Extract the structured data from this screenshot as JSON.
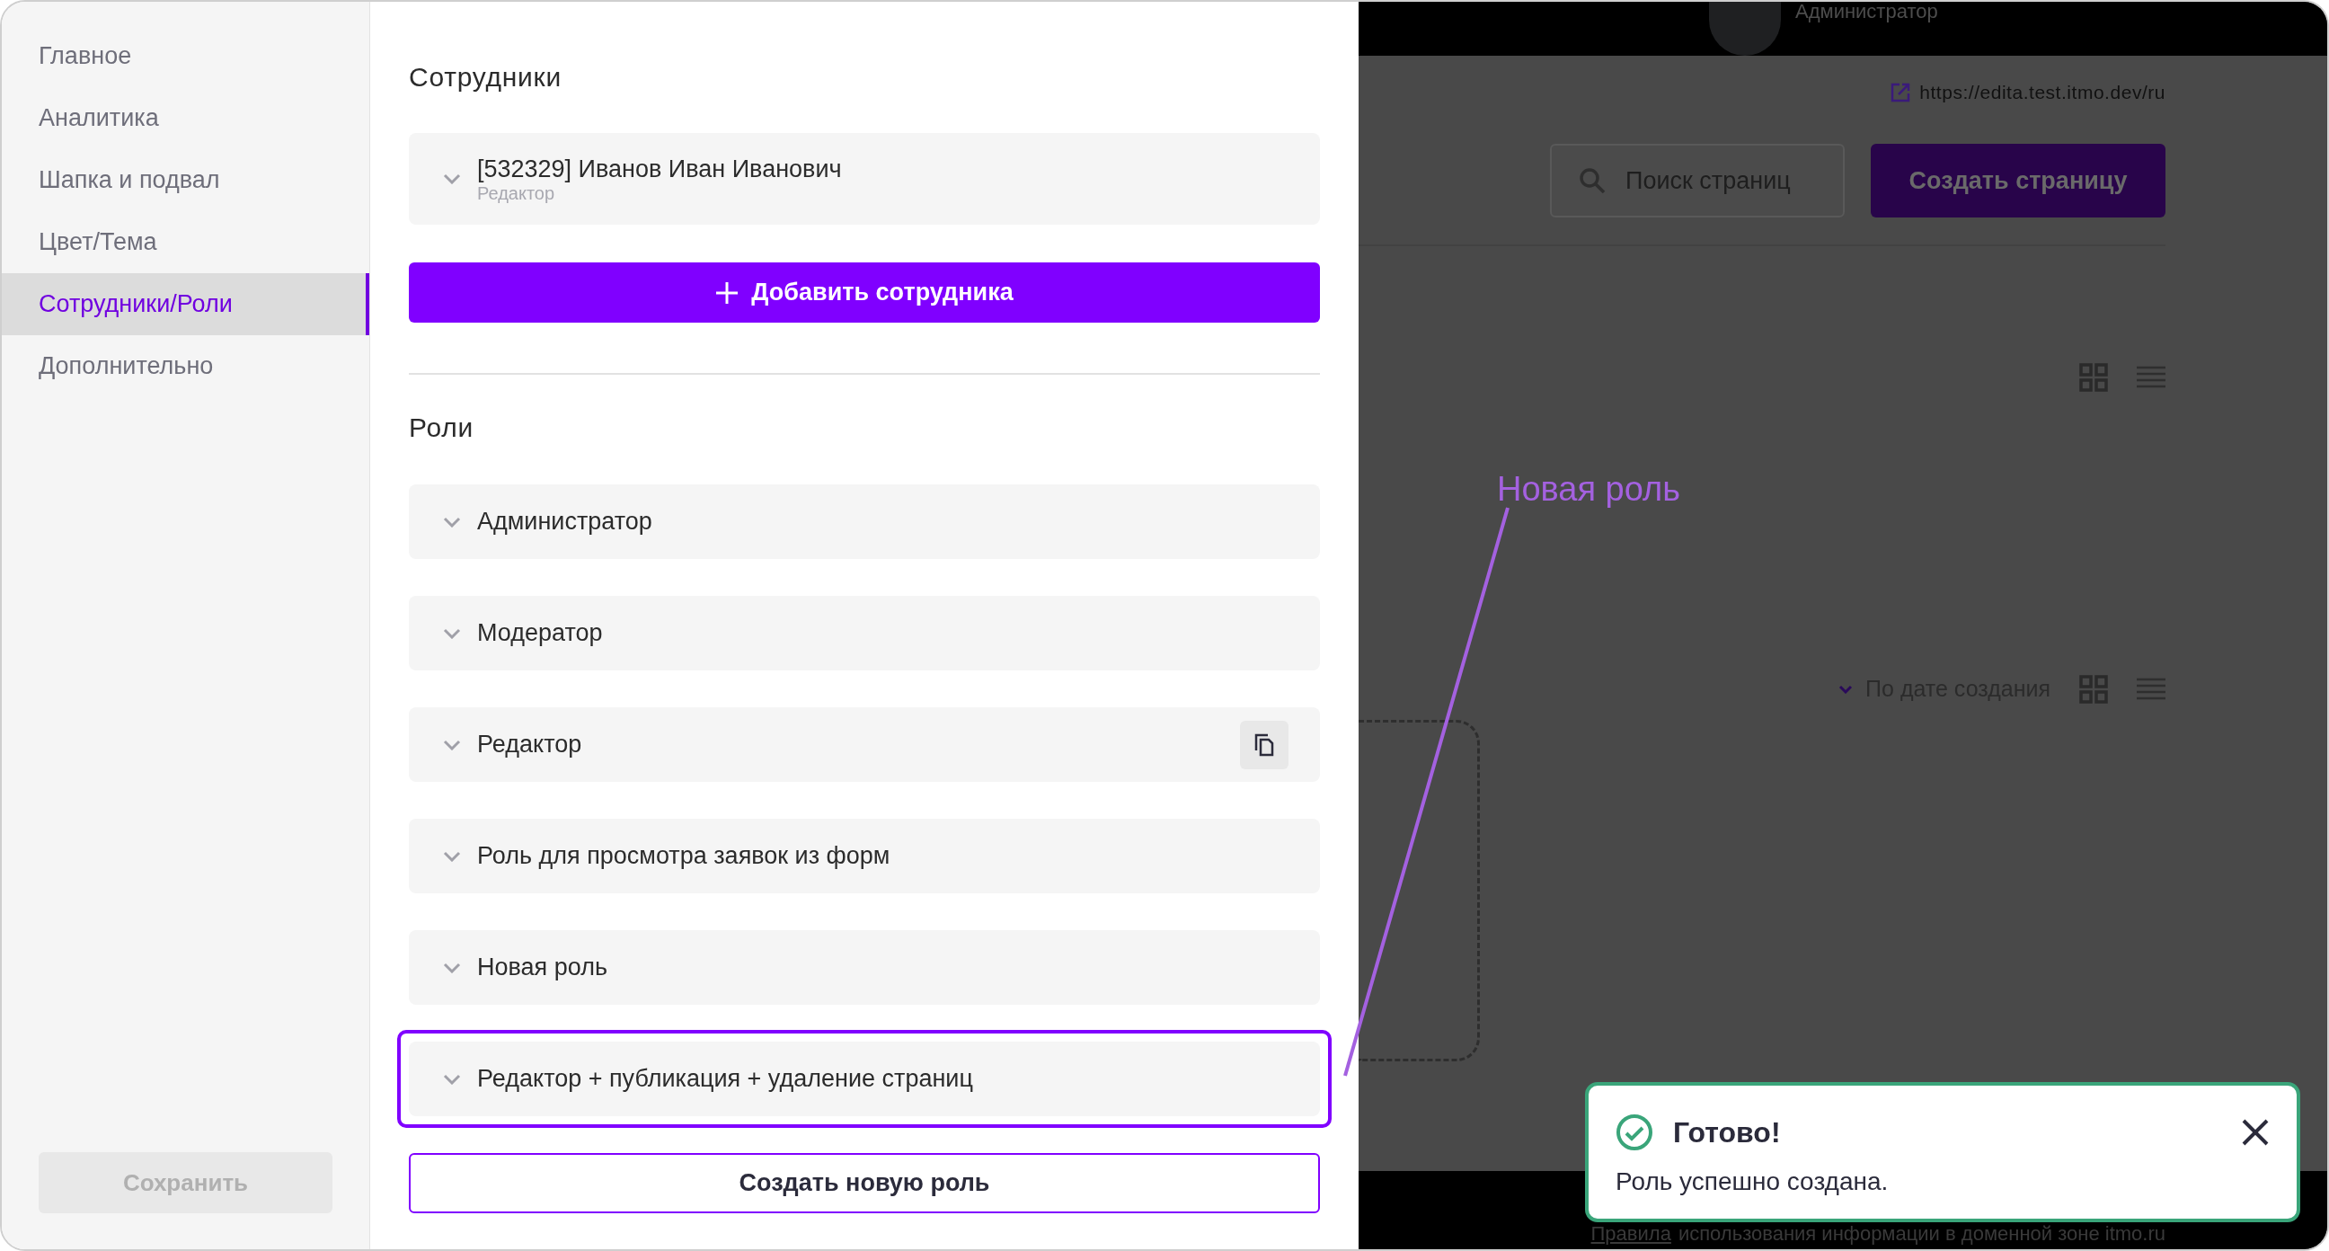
{
  "sidebar": {
    "items": [
      {
        "label": "Главное",
        "selected": false
      },
      {
        "label": "Аналитика",
        "selected": false
      },
      {
        "label": "Шапка и подвал",
        "selected": false
      },
      {
        "label": "Цвет/Тема",
        "selected": false
      },
      {
        "label": "Сотрудники/Роли",
        "selected": true
      },
      {
        "label": "Дополнительно",
        "selected": false
      }
    ],
    "save_button": {
      "label": "Сохранить",
      "disabled": true
    }
  },
  "employees": {
    "title": "Сотрудники",
    "items": [
      {
        "name": "[532329] Иванов Иван Иванович",
        "role": "Редактор"
      }
    ],
    "add_button": "Добавить сотрудника"
  },
  "roles": {
    "title": "Роли",
    "items": [
      {
        "label": "Администратор",
        "highlighted": false,
        "copy_button": false
      },
      {
        "label": "Модератор",
        "highlighted": false,
        "copy_button": false
      },
      {
        "label": "Редактор",
        "highlighted": false,
        "copy_button": true
      },
      {
        "label": "Роль для просмотра заявок из форм",
        "highlighted": false,
        "copy_button": false
      },
      {
        "label": "Новая роль",
        "highlighted": false,
        "copy_button": false
      },
      {
        "label": "Редактор + публикация + удаление страниц",
        "highlighted": true,
        "copy_button": false
      }
    ],
    "create_button": "Создать новую роль"
  },
  "background": {
    "header": {
      "user_role": "Администратор"
    },
    "site_link": "https://edita.test.itmo.dev/ru",
    "search": {
      "placeholder": "Поиск страниц"
    },
    "create_button": "Создать страницу",
    "sort": "По дате создания",
    "footer": {
      "link": "Правила",
      "text": "использования информации в доменной зоне itmo.ru"
    }
  },
  "annotation": "Новая роль",
  "toast": {
    "title": "Готово!",
    "message": "Роль успешно создана."
  }
}
